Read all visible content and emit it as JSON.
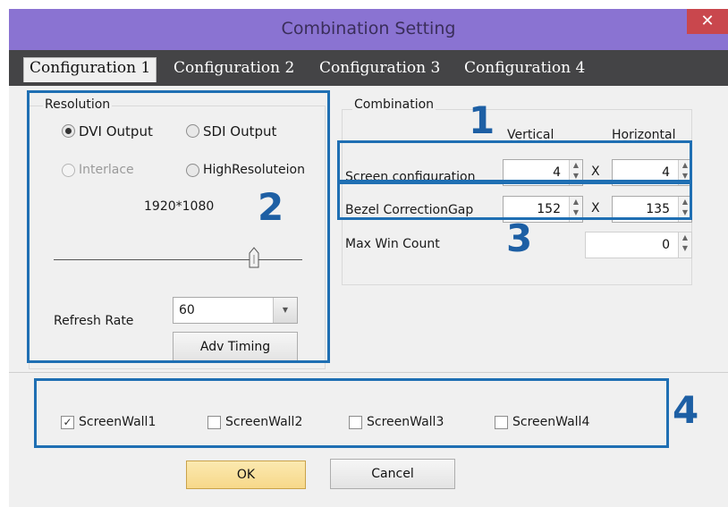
{
  "window": {
    "title": "Combination Setting",
    "close_icon": "close-icon"
  },
  "tabs": [
    {
      "label": "Configuration 1",
      "active": true
    },
    {
      "label": "Configuration 2",
      "active": false
    },
    {
      "label": "Configuration 3",
      "active": false
    },
    {
      "label": "Configuration 4",
      "active": false
    }
  ],
  "resolution": {
    "group_label": "Resolution",
    "dvi_label": "DVI Output",
    "sdi_label": "SDI Output",
    "interlace_label": "Interlace",
    "highres_label": "HighResoluteion",
    "resolution_value": "1920*1080",
    "refresh_label": "Refresh Rate",
    "refresh_value": "60",
    "adv_timing_label": "Adv Timing"
  },
  "combination": {
    "group_label": "Combination",
    "vertical_header": "Vertical",
    "horizontal_header": "Horizontal",
    "screen_config_label": "Screen configuration",
    "screen_config_vertical": "4",
    "screen_config_horizontal": "4",
    "bezel_label": "Bezel CorrectionGap",
    "bezel_vertical": "152",
    "bezel_horizontal": "135",
    "max_win_label": "Max Win Count",
    "max_win_value": "0",
    "times_symbol": "X"
  },
  "screenwalls": [
    {
      "label": "ScreenWall1",
      "checked": true
    },
    {
      "label": "ScreenWall2",
      "checked": false
    },
    {
      "label": "ScreenWall3",
      "checked": false
    },
    {
      "label": "ScreenWall4",
      "checked": false
    }
  ],
  "footer": {
    "ok_label": "OK",
    "cancel_label": "Cancel"
  },
  "annotations": {
    "n1": "1",
    "n2": "2",
    "n3": "3",
    "n4": "4"
  },
  "colors": {
    "titlebar": "#8a73d2",
    "close": "#c9474d",
    "annotation_blue": "#1f6fb3"
  }
}
